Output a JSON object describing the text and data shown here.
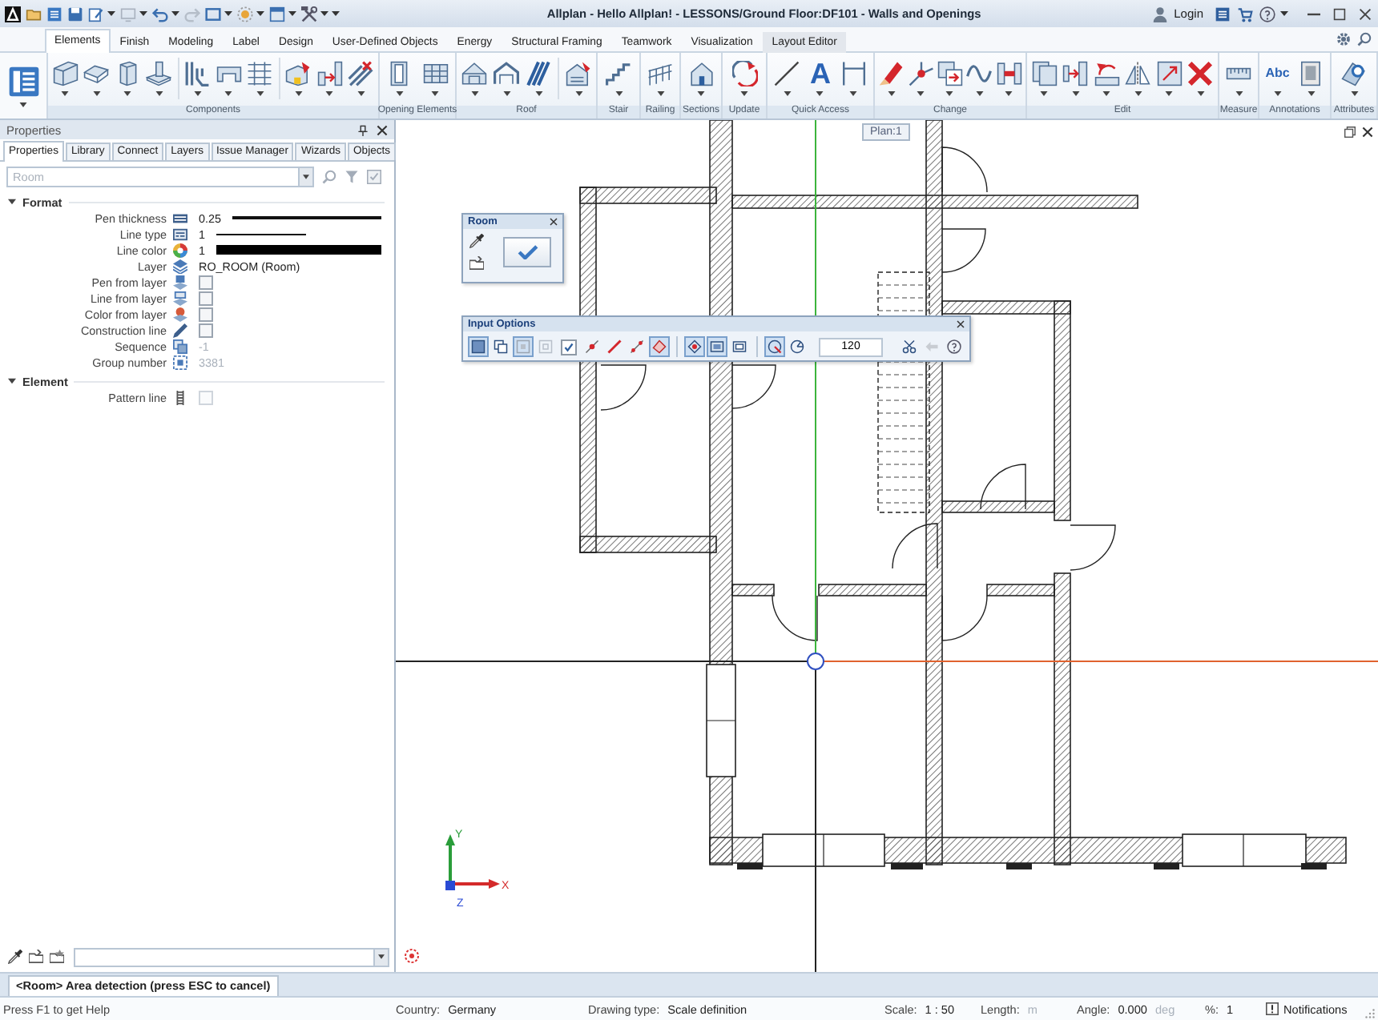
{
  "title_bar": {
    "title": "Allplan - Hello Allplan! - LESSONS/Ground Floor:DF101 - Walls and Openings",
    "login": "Login"
  },
  "ribbon": {
    "tabs": [
      {
        "label": "Elements",
        "selected": true,
        "highlighted": false
      },
      {
        "label": "Finish",
        "selected": false,
        "highlighted": false
      },
      {
        "label": "Modeling",
        "selected": false,
        "highlighted": false
      },
      {
        "label": "Label",
        "selected": false,
        "highlighted": false
      },
      {
        "label": "Design",
        "selected": false,
        "highlighted": false
      },
      {
        "label": "User-Defined Objects",
        "selected": false,
        "highlighted": false
      },
      {
        "label": "Energy",
        "selected": false,
        "highlighted": false
      },
      {
        "label": "Structural Framing",
        "selected": false,
        "highlighted": false
      },
      {
        "label": "Teamwork",
        "selected": false,
        "highlighted": false
      },
      {
        "label": "Visualization",
        "selected": false,
        "highlighted": false
      },
      {
        "label": "Layout Editor",
        "selected": false,
        "highlighted": true
      }
    ],
    "groups": [
      {
        "label": "Components"
      },
      {
        "label": "Opening Elements"
      },
      {
        "label": "Roof"
      },
      {
        "label": "Stair"
      },
      {
        "label": "Railing"
      },
      {
        "label": "Sections"
      },
      {
        "label": "Update"
      },
      {
        "label": "Quick Access",
        "glyphs": [
          "A"
        ]
      },
      {
        "label": "Change"
      },
      {
        "label": "Edit"
      },
      {
        "label": "Measure"
      },
      {
        "label": "Annotations",
        "glyphs": [
          "Abc"
        ]
      },
      {
        "label": "Attributes"
      }
    ]
  },
  "properties_panel": {
    "title": "Properties",
    "tabs": [
      {
        "label": "Properties",
        "selected": true
      },
      {
        "label": "Library",
        "selected": false
      },
      {
        "label": "Connect",
        "selected": false
      },
      {
        "label": "Layers",
        "selected": false
      },
      {
        "label": "Issue Manager",
        "selected": false
      },
      {
        "label": "Wizards",
        "selected": false
      },
      {
        "label": "Objects",
        "selected": false
      }
    ],
    "filter": {
      "placeholder": "Room"
    },
    "sections": [
      {
        "label": "Format",
        "expanded": true,
        "rows": [
          {
            "label": "Pen thickness",
            "kind": "thickness",
            "value": "0.25",
            "disabled": false
          },
          {
            "label": "Line type",
            "kind": "linetype",
            "value": "1",
            "disabled": false
          },
          {
            "label": "Line color",
            "kind": "color",
            "value": "1",
            "disabled": false
          },
          {
            "label": "Layer",
            "kind": "text",
            "value": "RO_ROOM (Room)",
            "disabled": false
          },
          {
            "label": "Pen from layer",
            "kind": "checkbox",
            "checked": false,
            "disabled": false
          },
          {
            "label": "Line from layer",
            "kind": "checkbox",
            "checked": false,
            "disabled": false
          },
          {
            "label": "Color from layer",
            "kind": "checkbox",
            "checked": false,
            "disabled": false
          },
          {
            "label": "Construction line",
            "kind": "checkbox",
            "checked": false,
            "disabled": false
          },
          {
            "label": "Sequence",
            "kind": "text",
            "value": "-1",
            "disabled": true
          },
          {
            "label": "Group number",
            "kind": "text",
            "value": "3381",
            "disabled": true
          }
        ]
      },
      {
        "label": "Element",
        "expanded": true,
        "rows": [
          {
            "label": "Pattern line",
            "kind": "checkbox",
            "checked": false,
            "disabled": true
          }
        ]
      }
    ]
  },
  "canvas": {
    "plan_label": "Plan:1",
    "axis_labels": [
      "Y",
      "X",
      "Z"
    ],
    "room_dialog": {
      "title": "Room"
    },
    "input_options": {
      "title": "Input Options",
      "toggles": [
        {
          "kind": "toggle",
          "selected": true
        },
        {
          "kind": "toggle",
          "selected": false
        },
        {
          "kind": "toggle",
          "selected": true
        },
        {
          "kind": "toggle",
          "selected": false
        },
        {
          "kind": "checkbox",
          "checked": true
        },
        {
          "kind": "toggle",
          "selected": false
        },
        {
          "kind": "toggle",
          "selected": false
        },
        {
          "kind": "toggle",
          "selected": false
        },
        {
          "kind": "toggle",
          "selected": true
        },
        {
          "kind": "toggle",
          "selected": true
        },
        {
          "kind": "toggle",
          "selected": true
        },
        {
          "kind": "toggle",
          "selected": false
        },
        {
          "kind": "toggle",
          "selected": true
        },
        {
          "kind": "toggle",
          "selected": false
        }
      ],
      "value": "120"
    }
  },
  "command_line": {
    "prompt": "<Room> Area detection (press ESC to cancel)"
  },
  "status_bar": {
    "help": "Press F1 to get Help",
    "fields": [
      {
        "label": "Country:",
        "value": "Germany"
      },
      {
        "label": "Drawing type:",
        "value": "Scale definition"
      },
      {
        "label": "Scale:",
        "value": "1 : 50"
      },
      {
        "label": "Length:",
        "unit": "m"
      },
      {
        "label": "Angle:",
        "value": "0.000",
        "unit": "deg"
      },
      {
        "label": "%:",
        "value": "1"
      }
    ],
    "notifications": "Notifications"
  }
}
